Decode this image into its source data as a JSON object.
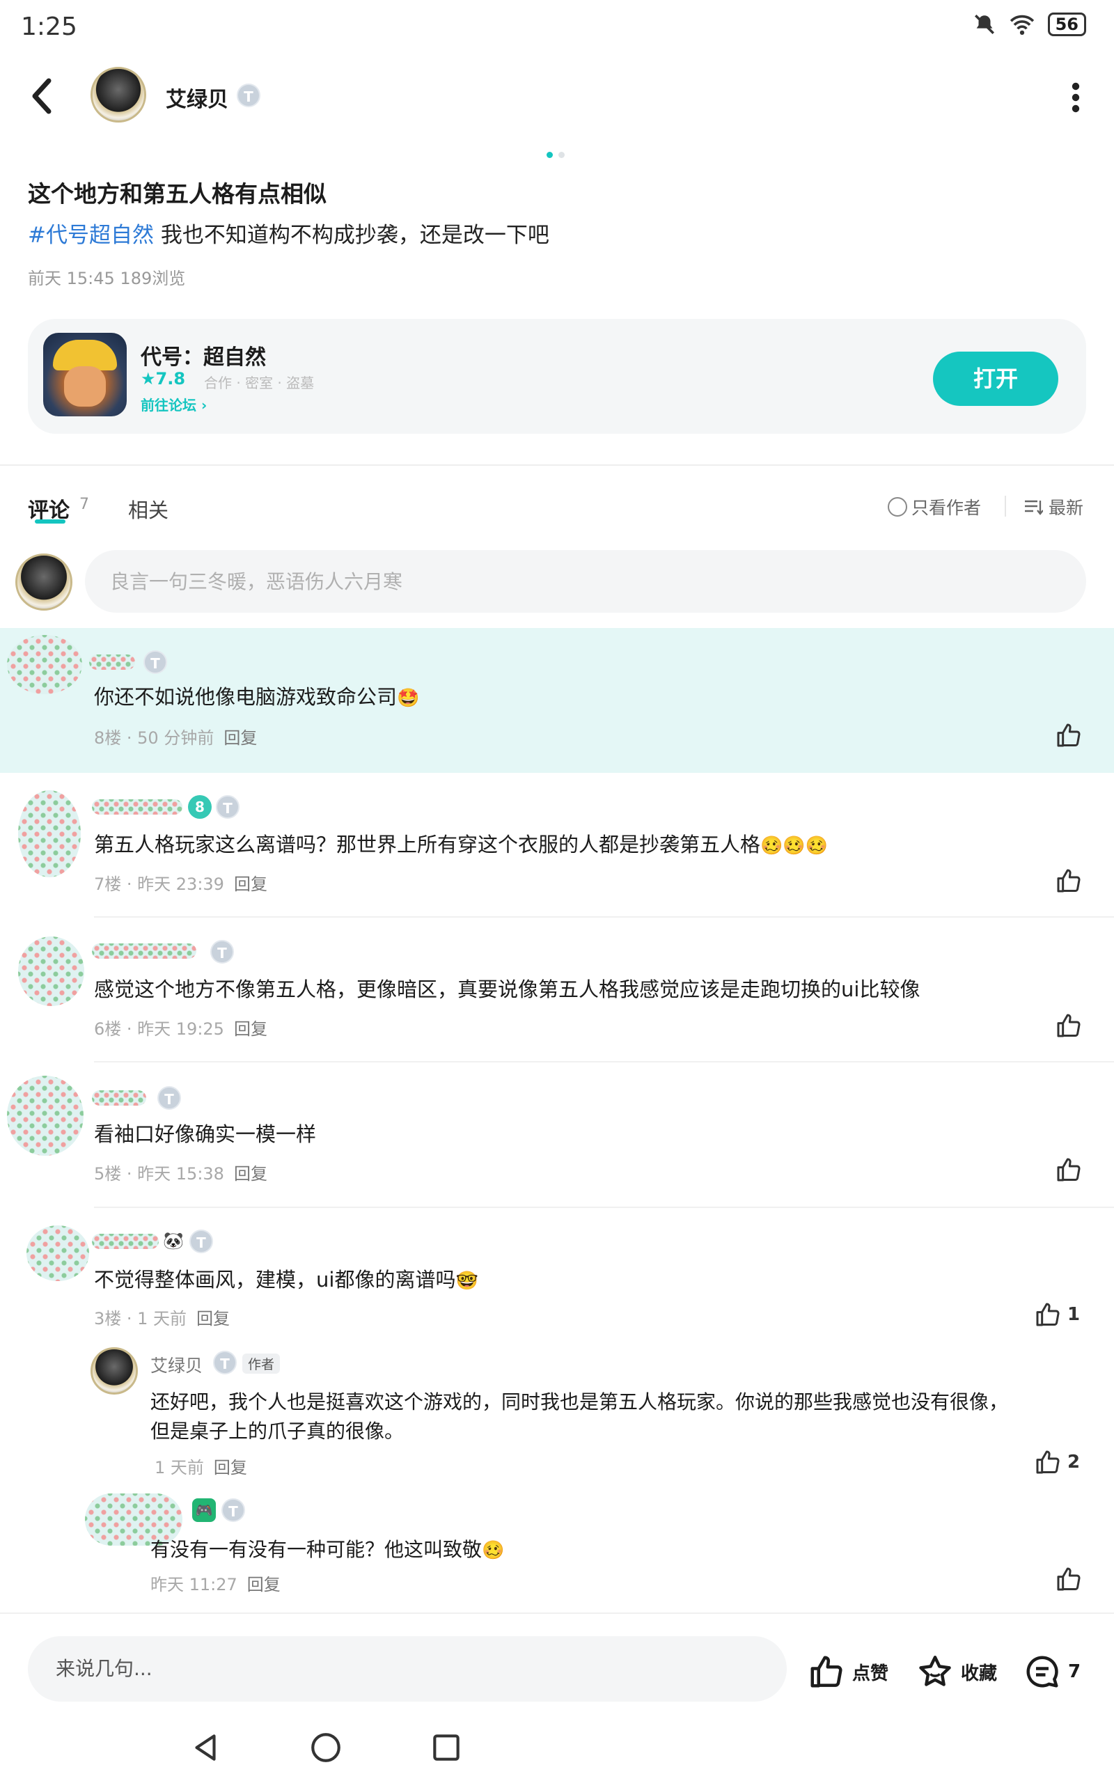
{
  "status_bar": {
    "time": "1:25",
    "battery": "56"
  },
  "header": {
    "author_name": "艾绿贝",
    "level_badge": "T",
    "back_icon": "chevron-left-icon",
    "more_icon": "more-vertical-icon"
  },
  "post": {
    "title": "这个地方和第五人格有点相似",
    "hashtag": "#代号超自然",
    "body": " 我也不知道构不构成抄袭，还是改一下吧",
    "meta": "前天 15:45  189浏览"
  },
  "game_card": {
    "name": "代号：超自然",
    "rating": "★7.8",
    "tags": "合作 · 密室 · 盗墓",
    "forum_link": "前往论坛 ›",
    "open_button": "打开"
  },
  "tabs": {
    "comments_label": "评论",
    "comments_count": "7",
    "related_label": "相关",
    "only_author": "只看作者",
    "sort_label": "最新"
  },
  "comment_input": {
    "placeholder": "良言一句三冬暖，恶语伤人六月寒"
  },
  "comments": [
    {
      "text": "你还不如说他像电脑游戏致命公司",
      "emoji": "🤩",
      "meta": "8楼 · 50 分钟前",
      "reply": "回复",
      "likes": ""
    },
    {
      "badge": "8",
      "text": "第五人格玩家这么离谱吗？那世界上所有穿这个衣服的人都是抄袭第五人格",
      "emoji": "🥴🥴🥴",
      "meta": "7楼 · 昨天 23:39",
      "reply": "回复",
      "likes": ""
    },
    {
      "text": "感觉这个地方不像第五人格，更像暗区，真要说像第五人格我感觉应该是走跑切换的ui比较像",
      "emoji": "",
      "meta": "6楼 · 昨天 19:25",
      "reply": "回复",
      "likes": ""
    },
    {
      "text": "看袖口好像确实一模一样",
      "emoji": "",
      "meta": "5楼 · 昨天 15:38",
      "reply": "回复",
      "likes": ""
    },
    {
      "text": "不觉得整体画风，建模，ui都像的离谱吗",
      "emoji": "🤓",
      "meta": "3楼 · 1 天前",
      "reply": "回复",
      "likes": "1"
    }
  ],
  "replies": [
    {
      "name": "艾绿贝",
      "tag": "作者",
      "text_line1": "还好吧，我个人也是挺喜欢这个游戏的，同时我也是第五人格玩家。你说的那些我感觉也没有很像，",
      "text_line2": "但是桌子上的爪子真的很像。",
      "meta": "1 天前",
      "reply": "回复",
      "likes": "2"
    },
    {
      "text": "有没有一有没有一种可能？他这叫致敬",
      "emoji": "🥴",
      "meta": "昨天 11:27",
      "reply": "回复",
      "likes": ""
    }
  ],
  "bottom_bar": {
    "input_placeholder": "来说几句...",
    "like_label": "点赞",
    "favorite_label": "收藏",
    "comment_count": "7"
  },
  "colors": {
    "accent": "#14c5c0",
    "hashtag": "#2d7ad6",
    "highlight_row": "#e4f7f6"
  }
}
